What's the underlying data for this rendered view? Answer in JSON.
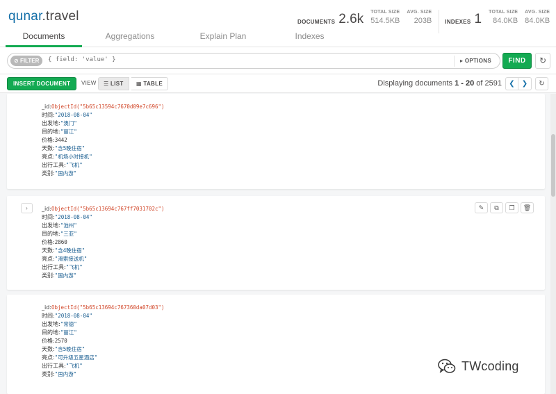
{
  "header": {
    "db": "qunar",
    "collection": ".travel",
    "tabs": [
      "Documents",
      "Aggregations",
      "Explain Plan",
      "Indexes"
    ],
    "stats": {
      "documents_label": "DOCUMENTS",
      "documents_value": "2.6k",
      "doc_total_size_label": "TOTAL SIZE",
      "doc_total_size": "514.5KB",
      "doc_avg_size_label": "AVG. SIZE",
      "doc_avg_size": "203B",
      "indexes_label": "INDEXES",
      "indexes_value": "1",
      "idx_total_size_label": "TOTAL SIZE",
      "idx_total_size": "84.0KB",
      "idx_avg_size_label": "AVG. SIZE",
      "idx_avg_size": "84.0KB"
    }
  },
  "querybar": {
    "filter_label": "FILTER",
    "filter_placeholder": "{ field: 'value' }",
    "options_label": "OPTIONS",
    "find_label": "FIND"
  },
  "toolbar": {
    "insert_label": "INSERT DOCUMENT",
    "view_label": "VIEW",
    "list_label": "LIST",
    "table_label": "TABLE",
    "pager_prefix": "Displaying documents ",
    "pager_range": "1 - 20",
    "pager_of": " of ",
    "pager_total": "2591"
  },
  "documents": [
    {
      "id": "ObjectId(\"5b65c13594c7670d09e7c696\")",
      "time": "\"2018-08-04\"",
      "from": "\"澳门\"",
      "dest": "\"丽江\"",
      "price": "3442",
      "days": "\"含5晚住宿\"",
      "highlight": "\"机场小时接机\"",
      "transport": "\"飞机\"",
      "category": "\"国内游\""
    },
    {
      "id": "ObjectId(\"5b65c13694c767ff7031702c\")",
      "time": "\"2018-08-04\"",
      "from": "\"池州\"",
      "dest": "\"三亚\"",
      "price": "2860",
      "days": "\"含4晚住宿\"",
      "highlight": "\"滑索接送机\"",
      "transport": "\"飞机\"",
      "category": "\"国内游\""
    },
    {
      "id": "ObjectId(\"5b65c13694c767360da07d03\")",
      "time": "\"2018-08-04\"",
      "from": "\"常德\"",
      "dest": "\"丽江\"",
      "price": "2570",
      "days": "\"含5晚住宿\"",
      "highlight": "\"可升级五星酒店\"",
      "transport": "\"飞机\"",
      "category": "\"国内游\""
    }
  ],
  "field_labels": {
    "id": "_id:",
    "time": "时间:",
    "from": "出发地:",
    "dest": "目的地:",
    "price": "价格:",
    "days": "天数:",
    "highlight": "亮点:",
    "transport": "出行工具:",
    "category": "类别:"
  },
  "watermark": {
    "text": "TWcoding"
  },
  "colors": {
    "accent": "#13aa52",
    "link": "#136fa8",
    "oid": "#d14527",
    "string": "#145a8e"
  }
}
